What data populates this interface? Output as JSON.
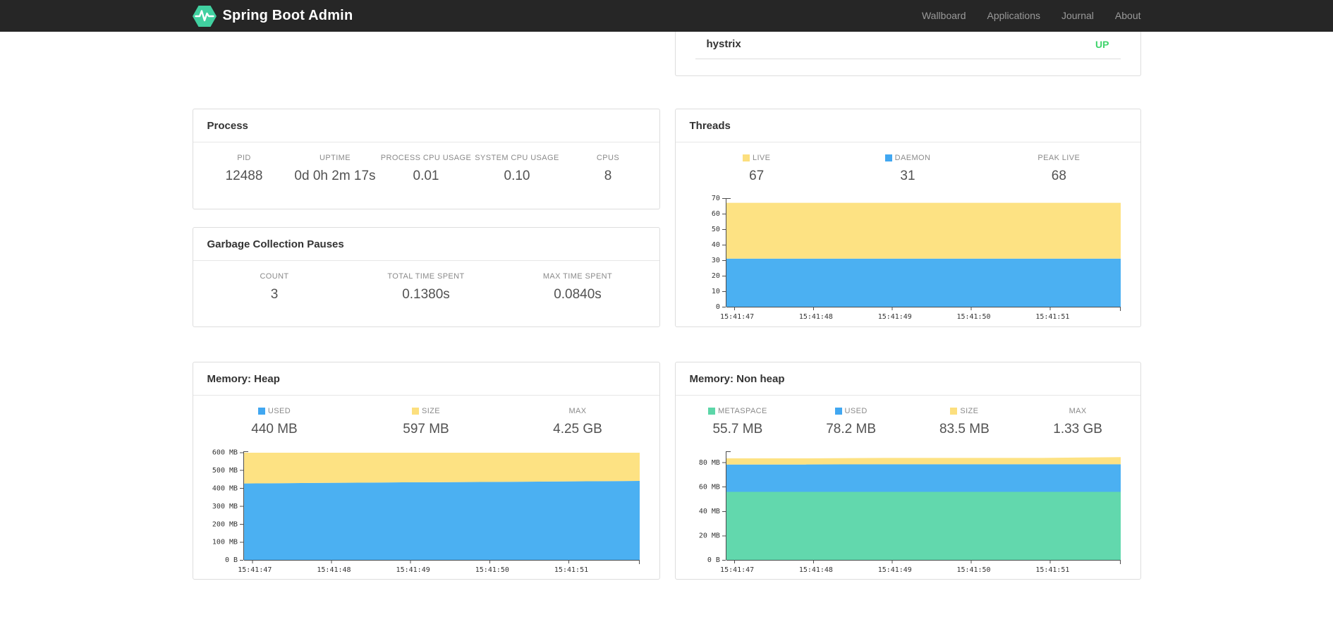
{
  "navbar": {
    "brand": "Spring Boot Admin",
    "logo_color": "#41d0a0",
    "items": [
      "Wallboard",
      "Applications",
      "Journal",
      "About"
    ]
  },
  "health_card": {
    "item": "hystrix",
    "status": "UP",
    "status_color": "#3fd46c"
  },
  "process_card": {
    "title": "Process",
    "stats": [
      {
        "label": "PID",
        "value": "12488"
      },
      {
        "label": "UPTIME",
        "value": "0d 0h 2m 17s"
      },
      {
        "label": "PROCESS CPU USAGE",
        "value": "0.01"
      },
      {
        "label": "SYSTEM CPU USAGE",
        "value": "0.10"
      },
      {
        "label": "CPUS",
        "value": "8"
      }
    ]
  },
  "gc_card": {
    "title": "Garbage Collection Pauses",
    "stats": [
      {
        "label": "COUNT",
        "value": "3"
      },
      {
        "label": "TOTAL TIME SPENT",
        "value": "0.1380s"
      },
      {
        "label": "MAX TIME SPENT",
        "value": "0.0840s"
      }
    ]
  },
  "threads_card": {
    "title": "Threads",
    "stats": [
      {
        "label": "LIVE",
        "value": "67",
        "color": "#fcdf7e"
      },
      {
        "label": "DAEMON",
        "value": "31",
        "color": "#41a7f1"
      },
      {
        "label": "PEAK LIVE",
        "value": "68"
      }
    ]
  },
  "heap_card": {
    "title": "Memory: Heap",
    "stats": [
      {
        "label": "USED",
        "value": "440 MB",
        "color": "#41a7f1"
      },
      {
        "label": "SIZE",
        "value": "597 MB",
        "color": "#fcdf7e"
      },
      {
        "label": "MAX",
        "value": "4.25 GB"
      }
    ]
  },
  "nonheap_card": {
    "title": "Memory: Non heap",
    "stats": [
      {
        "label": "METASPACE",
        "value": "55.7 MB",
        "color": "#5cd6a8"
      },
      {
        "label": "USED",
        "value": "78.2 MB",
        "color": "#41a7f1"
      },
      {
        "label": "SIZE",
        "value": "83.5 MB",
        "color": "#fcdf7e"
      },
      {
        "label": "MAX",
        "value": "1.33 GB"
      }
    ]
  },
  "chart_data": [
    {
      "id": "threads",
      "type": "area",
      "stacked": true,
      "title": "Threads over time",
      "ymax": 70,
      "grid": false,
      "legend_position": "above",
      "yticks": [
        {
          "value": 0,
          "label": "0"
        },
        {
          "value": 10,
          "label": "10"
        },
        {
          "value": 20,
          "label": "20"
        },
        {
          "value": 30,
          "label": "30"
        },
        {
          "value": 40,
          "label": "40"
        },
        {
          "value": 50,
          "label": "50"
        },
        {
          "value": 60,
          "label": "60"
        },
        {
          "value": 70,
          "label": "70"
        }
      ],
      "x_tick_labels": [
        "15:41:47",
        "15:41:48",
        "15:41:49",
        "15:41:50",
        "15:41:51"
      ],
      "series": [
        {
          "name": "DAEMON",
          "color": "#4bb0f2",
          "cumulative_values": [
            31,
            31,
            31,
            31,
            31,
            31
          ]
        },
        {
          "name": "LIVE",
          "color": "#fde283",
          "cumulative_values": [
            67,
            67,
            67,
            67,
            67,
            67
          ]
        }
      ]
    },
    {
      "id": "heap",
      "type": "area",
      "stacked": true,
      "title": "Heap memory over time",
      "ymax": 605,
      "grid": false,
      "legend_position": "above",
      "yticks": [
        {
          "value": 0,
          "label": "0 B"
        },
        {
          "value": 100,
          "label": "100 MB"
        },
        {
          "value": 200,
          "label": "200 MB"
        },
        {
          "value": 300,
          "label": "300 MB"
        },
        {
          "value": 400,
          "label": "400 MB"
        },
        {
          "value": 500,
          "label": "500 MB"
        },
        {
          "value": 600,
          "label": "600 MB"
        }
      ],
      "x_tick_labels": [
        "15:41:47",
        "15:41:48",
        "15:41:49",
        "15:41:50",
        "15:41:51"
      ],
      "series": [
        {
          "name": "USED",
          "color": "#4bb0f2",
          "cumulative_values": [
            426,
            429,
            432,
            434,
            437,
            440
          ]
        },
        {
          "name": "SIZE",
          "color": "#fde283",
          "cumulative_values": [
            597,
            597,
            597,
            597,
            597,
            597
          ]
        }
      ]
    },
    {
      "id": "nonheap",
      "type": "area",
      "stacked": true,
      "title": "Non heap memory over time",
      "ymax": 89,
      "grid": false,
      "legend_position": "above",
      "yticks": [
        {
          "value": 0,
          "label": "0 B"
        },
        {
          "value": 20,
          "label": "20 MB"
        },
        {
          "value": 40,
          "label": "40 MB"
        },
        {
          "value": 60,
          "label": "60 MB"
        },
        {
          "value": 80,
          "label": "80 MB"
        }
      ],
      "x_tick_labels": [
        "15:41:47",
        "15:41:48",
        "15:41:49",
        "15:41:50",
        "15:41:51"
      ],
      "series": [
        {
          "name": "METASPACE",
          "color": "#62d8ad",
          "cumulative_values": [
            55.8,
            55.8,
            55.8,
            55.8,
            55.8,
            55.8
          ]
        },
        {
          "name": "USED",
          "color": "#4bb0f2",
          "cumulative_values": [
            78.2,
            78.2,
            78.4,
            78.4,
            78.4,
            78.4
          ]
        },
        {
          "name": "SIZE",
          "color": "#fde283",
          "cumulative_values": [
            83.2,
            83.2,
            83.6,
            83.6,
            83.6,
            84.2
          ]
        }
      ]
    }
  ]
}
